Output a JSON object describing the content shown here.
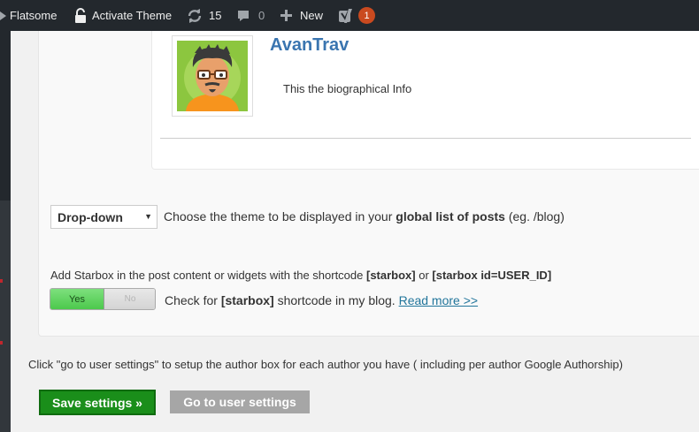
{
  "adminbar": {
    "site_name": "Flatsome",
    "activate_theme": "Activate Theme",
    "updates_count": "15",
    "comments_count": "0",
    "new_label": "New",
    "yoast_badge": "1"
  },
  "preview": {
    "author_name": "AvanTrav",
    "bio": "This the biographical Info"
  },
  "theme_select": {
    "selected": "Drop-down",
    "desc_prefix": "Choose the theme to be displayed in your ",
    "desc_bold": "global list of posts",
    "desc_suffix": " (eg. /blog)"
  },
  "shortcode": {
    "note_prefix": "Add Starbox in the post content or widgets with the shortcode ",
    "code1": "[starbox]",
    "note_mid": " or ",
    "code2": "[starbox id=USER_ID]",
    "toggle_yes": "Yes",
    "toggle_no": "No",
    "check_prefix": "Check for ",
    "check_code": "[starbox]",
    "check_suffix": " shortcode in my blog. ",
    "read_more": "Read more >>"
  },
  "footer": {
    "help_text": "Click \"go to user settings\" to setup the author box for each author you have ( including per author Google Authorship)",
    "save_button": "Save settings »",
    "user_settings_button": "Go to user settings"
  },
  "colors": {
    "adminbar_bg": "#23282d",
    "author_name": "#3a75b0",
    "save_green": "#1a8e1a",
    "link_blue": "#21759b",
    "badge_orange": "#ca4a1f"
  },
  "icons": [
    "wordpress-icon",
    "unlock-icon",
    "updates-icon",
    "comment-icon",
    "plus-icon",
    "yoast-icon"
  ]
}
